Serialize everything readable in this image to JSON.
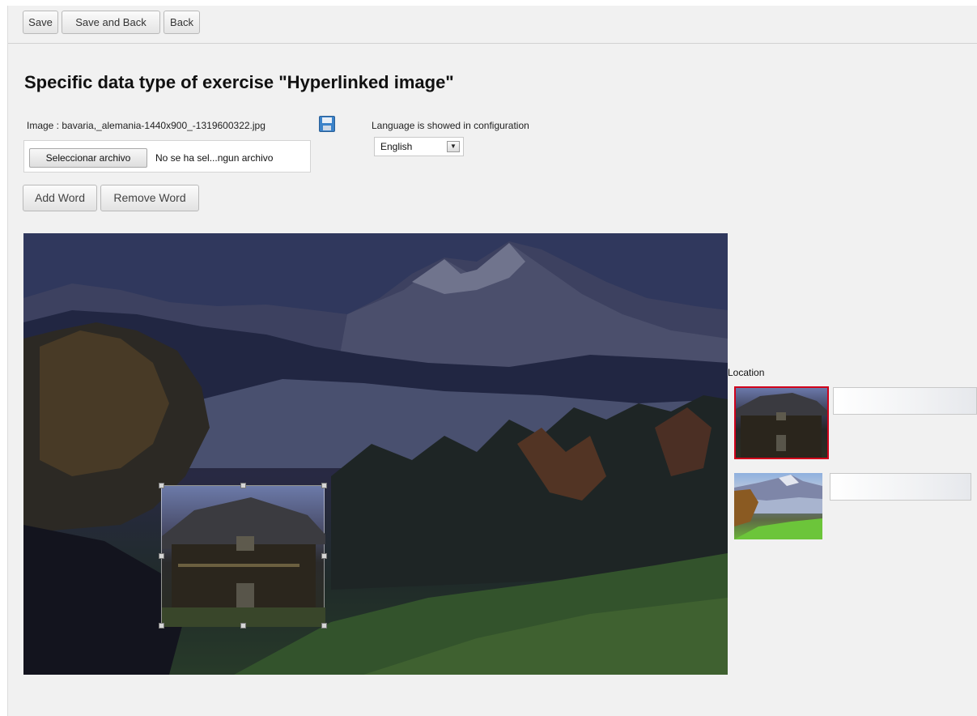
{
  "toolbar": {
    "save_label": "Save",
    "save_back_label": "Save and Back",
    "back_label": "Back"
  },
  "heading": {
    "title": "Specific data type of exercise \"Hyperlinked image\""
  },
  "image_field": {
    "label": "Image : bavaria,_alemania-1440x900_-1319600322.jpg",
    "save_icon": "floppy-disk-icon",
    "file_button_label": "Seleccionar archivo",
    "file_status": "No se ha sel...ngun archivo"
  },
  "language": {
    "label": "Language is showed in configuration",
    "selected": "English"
  },
  "word_buttons": {
    "add_label": "Add Word",
    "remove_label": "Remove Word"
  },
  "locations": {
    "label": "Location",
    "items": [
      {
        "value": "",
        "selected": true
      },
      {
        "value": "",
        "selected": false
      }
    ]
  },
  "colors": {
    "selected_border": "#d0021b",
    "page_background": "#f1f1f1"
  }
}
